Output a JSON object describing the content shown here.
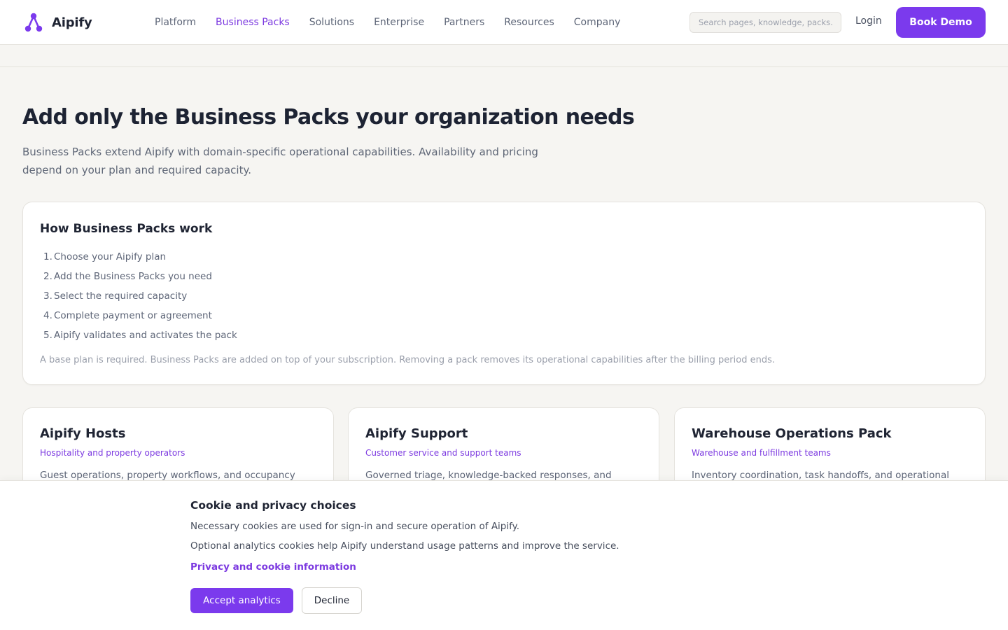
{
  "brand": {
    "name": "Aipify",
    "logo_icon": "aipify-logo-icon",
    "color": "#7b3aed"
  },
  "nav": {
    "items": [
      {
        "label": "Platform",
        "active": false
      },
      {
        "label": "Business Packs",
        "active": true
      },
      {
        "label": "Solutions",
        "active": false
      },
      {
        "label": "Enterprise",
        "active": false
      },
      {
        "label": "Partners",
        "active": false
      },
      {
        "label": "Resources",
        "active": false
      },
      {
        "label": "Company",
        "active": false
      }
    ],
    "search_placeholder": "Search pages, knowledge, packs…",
    "login_label": "Login",
    "book_demo_label": "Book Demo"
  },
  "hero": {
    "title": "Add only the Business Packs your organization needs",
    "subtitle": "Business Packs extend Aipify with domain-specific operational capabilities. Availability and pricing depend on your plan and required capacity."
  },
  "how_it_works": {
    "title": "How Business Packs work",
    "steps": [
      {
        "num": "1.",
        "text": "Choose your Aipify plan"
      },
      {
        "num": "2.",
        "text": "Add the Business Packs you need"
      },
      {
        "num": "3.",
        "text": "Select the required capacity"
      },
      {
        "num": "4.",
        "text": "Complete payment or agreement"
      },
      {
        "num": "5.",
        "text": "Aipify validates and activates the pack"
      }
    ],
    "note": "A base plan is required. Business Packs are added on top of your subscription. Removing a pack removes its operational capabilities after the billing period ends."
  },
  "packs": [
    {
      "title": "Aipify Hosts",
      "audience": "Hospitality and property operators",
      "description": "Guest operations, property workflows, and occupancy"
    },
    {
      "title": "Aipify Support",
      "audience": "Customer service and support teams",
      "description": "Governed triage, knowledge-backed responses, and"
    },
    {
      "title": "Warehouse Operations Pack",
      "audience": "Warehouse and fulfillment teams",
      "description": "Inventory coordination, task handoffs, and operational"
    }
  ],
  "cookie_banner": {
    "title": "Cookie and privacy choices",
    "line1": "Necessary cookies are used for sign-in and secure operation of Aipify.",
    "line2": "Optional analytics cookies help Aipify understand usage patterns and improve the service.",
    "link_label": "Privacy and cookie information",
    "accept_label": "Accept analytics",
    "decline_label": "Decline"
  }
}
